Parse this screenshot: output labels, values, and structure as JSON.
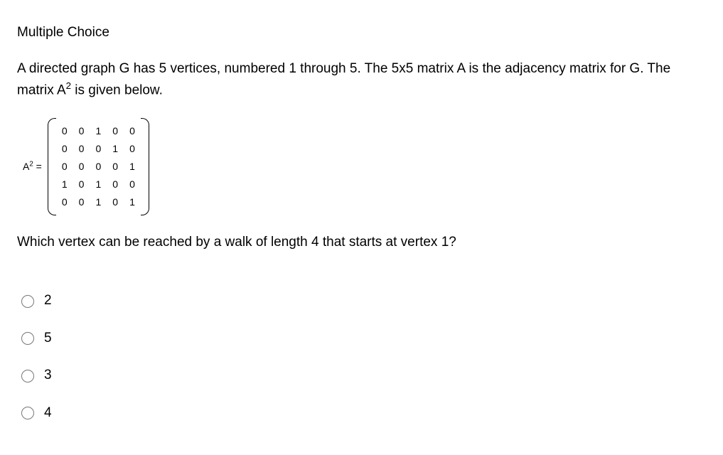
{
  "section_title": "Multiple Choice",
  "problem_line1": "A directed graph G has 5 vertices, numbered 1 through 5.  The 5x5 matrix A is the adjacency matrix for G.  The",
  "problem_line2_pre": "matrix A",
  "problem_line2_sup": "2",
  "problem_line2_post": " is given below.",
  "matrix_label_pre": "A",
  "matrix_label_sup": "2",
  "matrix_label_post": " = ",
  "matrix": [
    [
      "0",
      "0",
      "1",
      "0",
      "0"
    ],
    [
      "0",
      "0",
      "0",
      "1",
      "0"
    ],
    [
      "0",
      "0",
      "0",
      "0",
      "1"
    ],
    [
      "1",
      "0",
      "1",
      "0",
      "0"
    ],
    [
      "0",
      "0",
      "1",
      "0",
      "1"
    ]
  ],
  "question": "Which vertex can be reached by a walk of length 4 that starts at vertex 1?",
  "options": [
    "2",
    "5",
    "3",
    "4"
  ]
}
